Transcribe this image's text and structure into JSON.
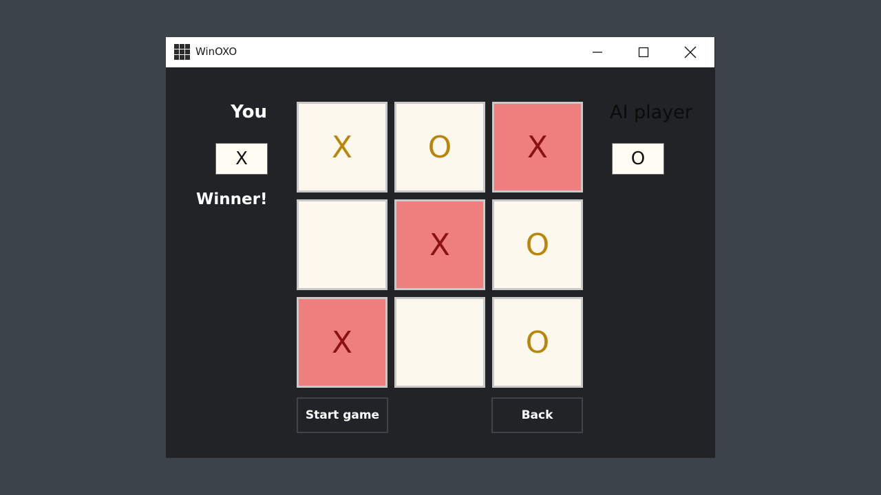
{
  "window": {
    "title": "WinOXO",
    "icon": "grid-app-icon",
    "controls": [
      "minimize-icon",
      "maximize-icon",
      "close-icon"
    ]
  },
  "player": {
    "label": "You",
    "symbol": "X",
    "status": "Winner!"
  },
  "ai": {
    "label": "AI player",
    "symbol": "O"
  },
  "board": {
    "cells": [
      "X",
      "O",
      "X",
      "",
      "X",
      "O",
      "X",
      "",
      "O"
    ],
    "winning_cells": [
      2,
      4,
      6
    ]
  },
  "buttons": {
    "start": "Start game",
    "back": "Back"
  },
  "colors": {
    "background": "#212327",
    "cell": "#fdf8ee",
    "cell_border": "#c9c9c9",
    "mark": "#b8860b",
    "win_cell": "#ef7f7f",
    "win_mark": "#8b1212"
  }
}
